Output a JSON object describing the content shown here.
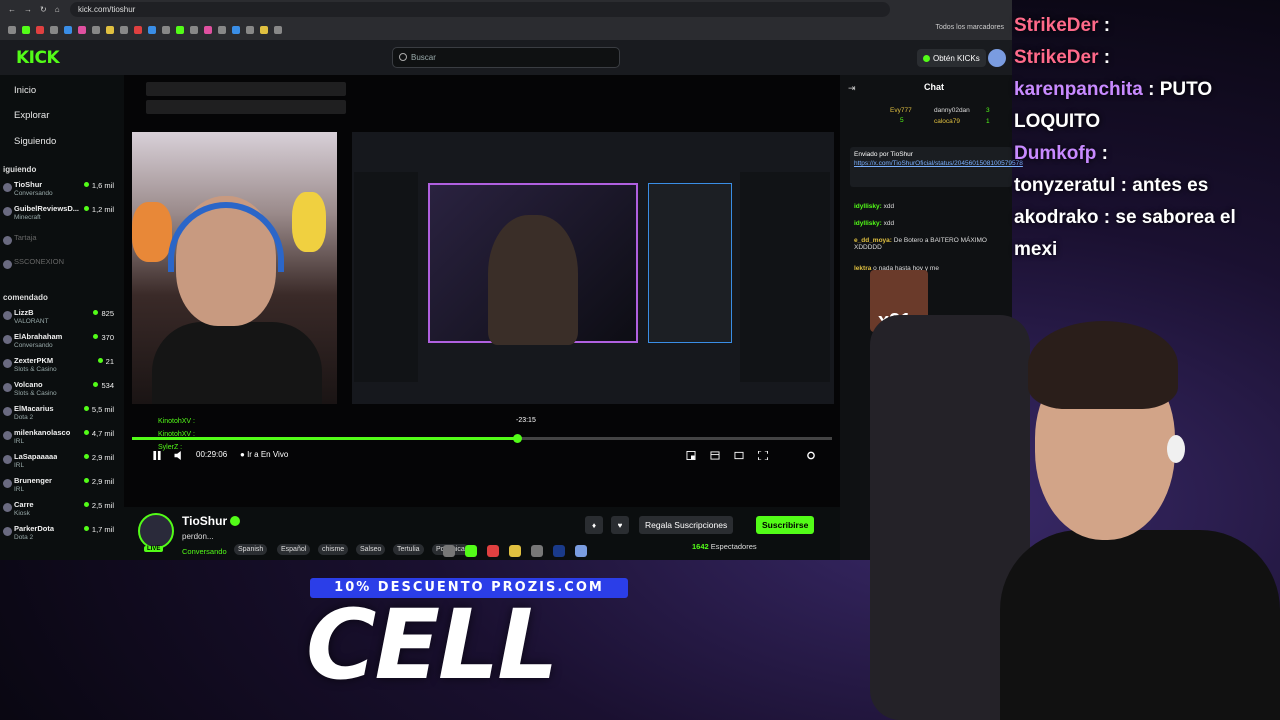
{
  "browser": {
    "url": "kick.com/tioshur",
    "bookmarks_folder": "Todos los marcadores"
  },
  "kick": {
    "search_placeholder": "Buscar",
    "kicks_button": "Obtén KICKs",
    "logo": "KICK",
    "nav": [
      "Inicio",
      "Explorar",
      "Siguiendo"
    ],
    "following_title": "iguiendo",
    "following": [
      {
        "name": "TioShur",
        "category": "Conversando",
        "viewers": "1,6 mil"
      },
      {
        "name": "GuibelReviewsD...",
        "category": "Minecraft",
        "viewers": "1,2 mil"
      },
      {
        "name": "Tartaja",
        "category": "",
        "viewers": ""
      },
      {
        "name": "SSCONEXION",
        "category": "",
        "viewers": ""
      }
    ],
    "recommended_title": "comendado",
    "recommended": [
      {
        "name": "LizzB",
        "category": "VALORANT",
        "viewers": "825"
      },
      {
        "name": "ElAbrahaham",
        "category": "Conversando",
        "viewers": "370"
      },
      {
        "name": "ZexterPKM",
        "category": "Slots & Casino",
        "viewers": "21"
      },
      {
        "name": "Volcano",
        "category": "Slots & Casino",
        "viewers": "534"
      },
      {
        "name": "ElMacarius",
        "category": "Dota 2",
        "viewers": "5,5 mil"
      },
      {
        "name": "milenkanolasco",
        "category": "IRL",
        "viewers": "4,7 mil"
      },
      {
        "name": "LaSapaaaaa",
        "category": "IRL",
        "viewers": "2,9 mil"
      },
      {
        "name": "Brunenger",
        "category": "IRL",
        "viewers": "2,9 mil"
      },
      {
        "name": "Carre",
        "category": "Kiosk",
        "viewers": "2,5 mil"
      },
      {
        "name": "ParkerDota",
        "category": "Dota 2",
        "viewers": "1,7 mil"
      }
    ],
    "player": {
      "overlay_names": [
        "KinotohXV :",
        "KinotohXV :",
        "SylerZ :"
      ],
      "hover_time": "-23:15",
      "time": "00:29:06",
      "live_link": "Ir a En Vivo",
      "progress": 0.55
    },
    "stream": {
      "streamer": "TioShur",
      "title": "perdon...",
      "category": "Conversando",
      "tags": [
        "Spanish",
        "Español",
        "chisme",
        "Salseo",
        "Tertulia",
        "Polémica"
      ],
      "gift_button": "Regala Suscripciones",
      "subscribe_button": "Suscribirse",
      "viewers": "1642",
      "viewers_label": "Espectadores",
      "live_badge": "LIVE"
    },
    "chat": {
      "title": "Chat",
      "top_gifters": [
        {
          "name": "Evy777",
          "count": "5"
        },
        {
          "name": "danny02dan",
          "count": "3"
        },
        {
          "name": "caloca79",
          "count": "1"
        }
      ],
      "pinned_by_label": "Enviado por",
      "pinned_by": "TioShur",
      "pinned_link": "https://x.com/TioShurOficial/status/2045601508100579578",
      "messages": [
        {
          "user": "idyllisky:",
          "text": "xdd"
        },
        {
          "user": "idyllisky:",
          "text": "xdd"
        },
        {
          "user": "e_dd_moya:",
          "text": "De Botero a BAITERO MÁXIMO XDDDDD"
        },
        {
          "user": "lektra",
          "text": "o nada hasta hoy y me"
        }
      ],
      "emote_text": "x21"
    }
  },
  "overlay_chat": [
    {
      "user": "StrikeDer",
      "text": ":"
    },
    {
      "user": "StrikeDer",
      "text": ":"
    },
    {
      "user": "karenpanchita",
      "text": ": PUTO LOQUITO"
    },
    {
      "user": "Dumkofp",
      "text": ":"
    },
    {
      "user": "tonyzeratul",
      "text": ": antes es"
    },
    {
      "user": "akodrako",
      "text": ": se saborea el mexi"
    }
  ],
  "promo": {
    "banner": "10% DESCUENTO PROZIS.COM",
    "big_text": "CELL"
  },
  "colors": {
    "kick_green": "#53fc18",
    "promo_blue": "#2b3ee8"
  }
}
